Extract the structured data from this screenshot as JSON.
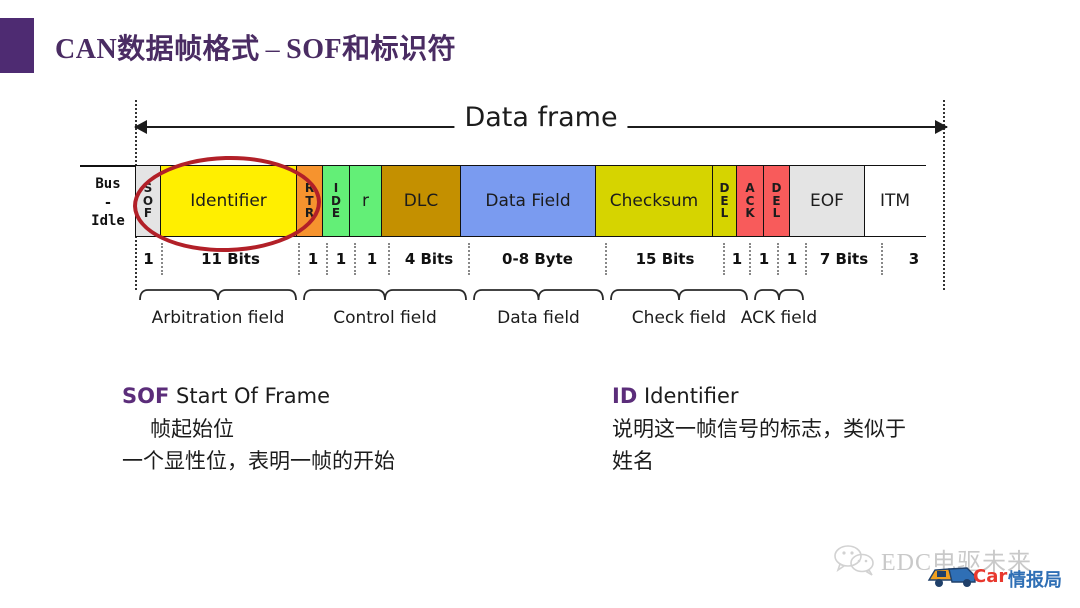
{
  "slide": {
    "title_main": "CAN数据帧格式",
    "title_dash": "–",
    "title_sub": "SOF和标识符",
    "accent_color": "#4e2b72"
  },
  "diagram": {
    "overall_label": "Data frame",
    "bus_idle": {
      "line1": "Bus",
      "line2": "-",
      "line3": "Idle"
    },
    "fields": [
      {
        "name": "SOF",
        "label": "SOF",
        "orientation": "vertical",
        "bits": "1",
        "width": 27,
        "color": "#e4e4e4"
      },
      {
        "name": "Identifier",
        "label": "Identifier",
        "orientation": "horizontal",
        "bits": "11 Bits",
        "width": 137,
        "color": "#ffef00"
      },
      {
        "name": "RTR",
        "label": "RTR",
        "orientation": "vertical",
        "bits": "1",
        "width": 28,
        "color": "#f6932e"
      },
      {
        "name": "IDE",
        "label": "IDE",
        "orientation": "vertical",
        "bits": "1",
        "width": 28,
        "color": "#63ef77"
      },
      {
        "name": "r",
        "label": "r",
        "orientation": "horizontal",
        "bits": "1",
        "width": 34,
        "color": "#63ef77"
      },
      {
        "name": "DLC",
        "label": "DLC",
        "orientation": "horizontal",
        "bits": "4 Bits",
        "width": 80,
        "color": "#c49000"
      },
      {
        "name": "Data Field",
        "label": "Data Field",
        "orientation": "horizontal",
        "bits": "0-8 Byte",
        "width": 137,
        "color": "#7a9bf0"
      },
      {
        "name": "Checksum",
        "label": "Checksum",
        "orientation": "horizontal",
        "bits": "15 Bits",
        "width": 118,
        "color": "#d6d400"
      },
      {
        "name": "DEL1",
        "label": "DEL",
        "orientation": "vertical",
        "bits": "1",
        "width": 26,
        "color": "#d6d400"
      },
      {
        "name": "ACK",
        "label": "ACK",
        "orientation": "vertical",
        "bits": "1",
        "width": 28,
        "color": "#f85b5b"
      },
      {
        "name": "DEL2",
        "label": "DEL",
        "orientation": "vertical",
        "bits": "1",
        "width": 28,
        "color": "#f85b5b"
      },
      {
        "name": "EOF",
        "label": "EOF",
        "orientation": "horizontal",
        "bits": "7 Bits",
        "width": 76,
        "color": "#e4e4e4"
      },
      {
        "name": "ITM",
        "label": "ITM",
        "orientation": "horizontal",
        "bits": "3",
        "width": 62,
        "color": "#ffffff"
      }
    ],
    "groups": [
      {
        "label": "Arbitration field",
        "start": 0,
        "end": 2
      },
      {
        "label": "Control field",
        "start": 2,
        "end": 6
      },
      {
        "label": "Data field",
        "start": 6,
        "end": 7
      },
      {
        "label": "Check field",
        "start": 7,
        "end": 9
      },
      {
        "label": "ACK field",
        "start": 9,
        "end": 11
      }
    ],
    "highlight": {
      "shape": "ellipse",
      "color": "#b22028",
      "covers": "SOF + Identifier"
    }
  },
  "legend": {
    "sof": {
      "abbr": "SOF",
      "expansion": "Start Of Frame",
      "line2": "帧起始位",
      "line3": "一个显性位，表明一帧的开始"
    },
    "id": {
      "abbr": "ID",
      "expansion": "Identifier",
      "line2": "说明这一帧信号的标志，类似于",
      "line3": "姓名"
    }
  },
  "watermark": {
    "account": "EDC电驱未来",
    "brand_en": "Car",
    "brand_cn": "情报局"
  }
}
